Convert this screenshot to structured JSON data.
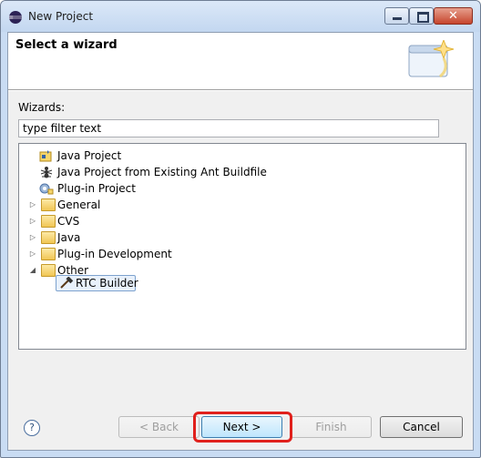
{
  "window": {
    "title": "New Project"
  },
  "header": {
    "title": "Select a wizard"
  },
  "wizards_label": "Wizards:",
  "filter": {
    "value": "type filter text"
  },
  "tree": {
    "items": [
      {
        "label": "Java Project",
        "icon": "java-project-icon"
      },
      {
        "label": "Java Project from Existing Ant Buildfile",
        "icon": "ant-icon"
      },
      {
        "label": "Plug-in Project",
        "icon": "plugin-project-icon"
      },
      {
        "label": "General",
        "icon": "folder-icon",
        "expanded": false
      },
      {
        "label": "CVS",
        "icon": "folder-icon",
        "expanded": false
      },
      {
        "label": "Java",
        "icon": "folder-icon",
        "expanded": false
      },
      {
        "label": "Plug-in Development",
        "icon": "folder-icon",
        "expanded": false
      },
      {
        "label": "Other",
        "icon": "folder-icon",
        "expanded": true
      },
      {
        "label": "RTC Builder",
        "icon": "hammer-icon",
        "selected": true
      }
    ]
  },
  "buttons": {
    "help": "?",
    "back": "< Back",
    "next": "Next >",
    "finish": "Finish",
    "cancel": "Cancel"
  },
  "colors": {
    "highlight": "#e0201c",
    "titlebar": "#c9dcf3",
    "close": "#c6452d"
  }
}
